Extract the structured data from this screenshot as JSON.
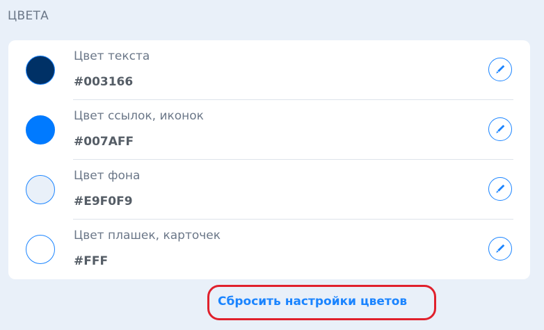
{
  "section": {
    "title": "ЦВЕТА"
  },
  "colors": [
    {
      "label": "Цвет текста",
      "value": "#003166",
      "swatch_fill": "#003166",
      "swatch_border": "#1A84FF",
      "edit_icon": "pencil-icon"
    },
    {
      "label": "Цвет ссылок, иконок",
      "value": "#007AFF",
      "swatch_fill": "#007AFF",
      "swatch_border": "#007AFF",
      "edit_icon": "pencil-icon"
    },
    {
      "label": "Цвет фона",
      "value": "#E9F0F9",
      "swatch_fill": "#E9F0F9",
      "swatch_border": "#1A84FF",
      "edit_icon": "pencil-icon"
    },
    {
      "label": "Цвет плашек, карточек",
      "value": "#FFF",
      "swatch_fill": "#FFFFFF",
      "swatch_border": "#1A84FF",
      "edit_icon": "pencil-icon"
    }
  ],
  "reset": {
    "label": "Сбросить настройки цветов"
  },
  "theme": {
    "accent": "#1A84FF",
    "highlight": "#E0202C",
    "page_background": "#E9F0F9",
    "card_background": "#FFFFFF"
  }
}
